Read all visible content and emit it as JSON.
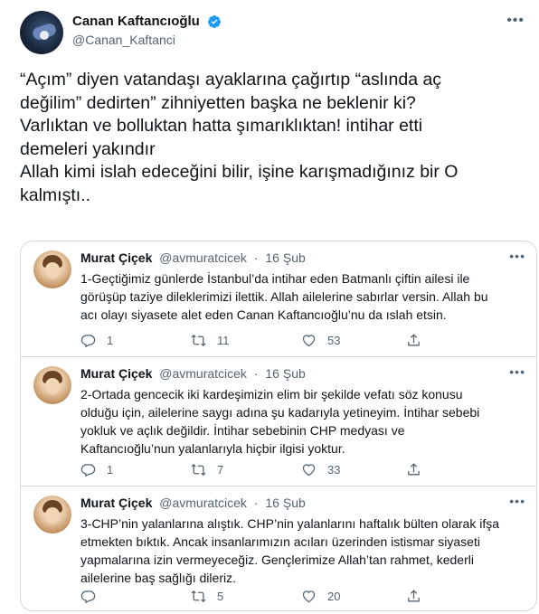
{
  "author": {
    "display_name": "Canan Kaftancıoğlu",
    "handle": "@Canan_Kaftanci",
    "verified_icon": "verified-badge-icon",
    "more_icon": "more-options-icon"
  },
  "tweet_lines": [
    "“Açım” diyen vatandaşı ayaklarına çağırtıp  “aslında aç",
    "değilim” dedirten” zihniyetten başka ne beklenir ki?",
    "Varlıktan ve bolluktan hatta şımarıklıktan! intihar etti",
    "demeleri yakındır",
    "Allah kimi islah edeceğini bilir, işine karışmadığınız bir O",
    "kalmıştı.."
  ],
  "quoted_thread": [
    {
      "name": "Murat Çiçek",
      "handle": "@avmuratcicek",
      "separator": "·",
      "date": "16 Şub",
      "lines": [
        "1-Geçtiğimiz günlerde İstanbul’da intihar eden Batmanlı çiftin ailesi ile",
        "görüşüp taziye dileklerimizi ilettik. Allah ailelerine sabırlar versin. Allah bu",
        "acı olayı siyasete alet eden Canan Kaftancıoğlu’nu da ıslah etsin."
      ],
      "reply_count": "1",
      "retweet_count": "11",
      "like_count": "53"
    },
    {
      "name": "Murat Çiçek",
      "handle": "@avmuratcicek",
      "separator": "·",
      "date": "16 Şub",
      "lines": [
        "2-Ortada gencecik iki kardeşimizin elim bir şekilde vefatı söz konusu",
        "olduğu için, ailelerine saygı adına şu kadarıyla yetineyim. İntihar sebebi",
        "yokluk ve açlık değildir. İntihar sebebinin CHP medyası ve",
        "Kaftancıoğlu’nun yalanlarıyla hiçbir ilgisi yoktur."
      ],
      "reply_count": "1",
      "retweet_count": "7",
      "like_count": "33"
    },
    {
      "name": "Murat Çiçek",
      "handle": "@avmuratcicek",
      "separator": "·",
      "date": "16 Şub",
      "lines": [
        "3-CHP’nin yalanlarına alıştık. CHP’nin yalanlarını haftalık bülten olarak ifşa",
        "etmekten bıktık. Ancak insanlarımızın acıları üzerinden istismar siyaseti",
        "yapmalarına izin vermeyeceğiz. Gençlerimize Allah’tan rahmet, kederli",
        "ailelerine baş sağlığı dileriz."
      ],
      "reply_count": "",
      "retweet_count": "5",
      "like_count": "20"
    }
  ],
  "colors": {
    "text": "#0f1419",
    "secondary": "#536471",
    "border": "#cfd9de",
    "verified": "#1d9bf0"
  }
}
